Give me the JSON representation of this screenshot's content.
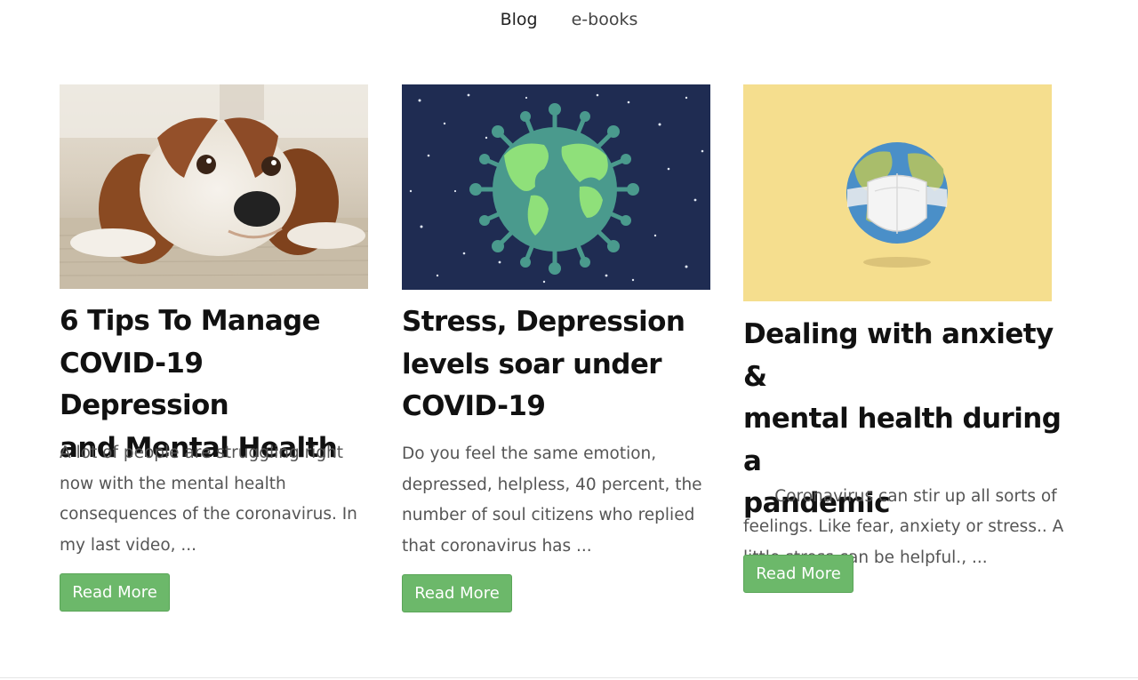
{
  "nav": {
    "items": [
      {
        "label": "Blog"
      },
      {
        "label": "e-books"
      }
    ]
  },
  "posts": [
    {
      "title_lines": [
        "6 Tips To Manage",
        "COVID-19 Depression",
        "and Mental Health"
      ],
      "excerpt_lines": [
        "A lot of people are struggling right",
        "now with the mental health",
        "consequences of the coronavirus. In",
        "my last video, ..."
      ],
      "button": "Read More",
      "image": "dog-lying-on-rug-photo"
    },
    {
      "title_lines": [
        "Stress, Depression",
        "levels soar under",
        "COVID-19"
      ],
      "excerpt_lines": [
        "Do you feel the same emotion,",
        "depressed, helpless, 40 percent, the",
        "number of soul citizens who replied",
        "that coronavirus has ..."
      ],
      "button": "Read More",
      "image": "virus-globe-illustration"
    },
    {
      "title_lines": [
        "Dealing with anxiety &",
        "mental health during a",
        "pandemic"
      ],
      "excerpt_lines": [
        "  Coronavirus can stir up all sorts of",
        "feelings. Like fear, anxiety or stress.. A",
        "little stress can be helpful., ..."
      ],
      "button": "Read More",
      "image": "globe-with-face-mask-illustration"
    }
  ],
  "colors": {
    "button": "#6cb86a",
    "space_bg": "#1f2c52",
    "card3_bg": "#f5de8e"
  }
}
